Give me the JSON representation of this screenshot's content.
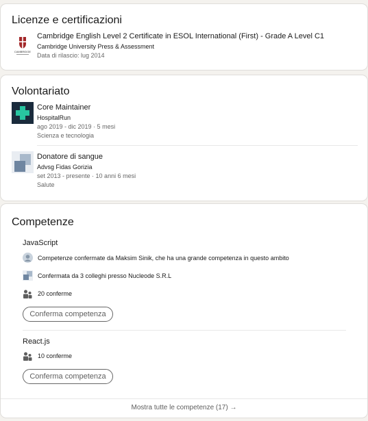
{
  "licenses": {
    "title": "Licenze e certificazioni",
    "items": [
      {
        "name": "Cambridge English Level 2 Certificate in ESOL International (First) - Grade A Level C1",
        "issuer": "Cambridge University Press & Assessment",
        "date": "Data di rilascio: lug 2014",
        "logo_text": "CAMBRIDGE"
      }
    ]
  },
  "volunteering": {
    "title": "Volontariato",
    "items": [
      {
        "role": "Core Maintainer",
        "org": "HospitalRun",
        "dates": "ago 2019 - dic 2019 · 5 mesi",
        "cause": "Scienza e tecnologia",
        "logo_bg": "#1a2b3c",
        "logo_accent": "#28c5a0"
      },
      {
        "role": "Donatore di sangue",
        "org": "Advsg Fidas Gorizia",
        "dates": "set 2013 - presente · 10 anni 6 mesi",
        "cause": "Salute"
      }
    ]
  },
  "skills": {
    "title": "Competenze",
    "items": [
      {
        "name": "JavaScript",
        "endorse_person": "Competenze confermate da Maksim Sinik, che ha una grande competenza in questo ambito",
        "endorse_colleagues": "Confermata da 3 colleghi presso Nucleode S.R.L",
        "count": "20 conferme",
        "button": "Conferma competenza"
      },
      {
        "name": "React.js",
        "count": "10 conferme",
        "button": "Conferma competenza"
      }
    ],
    "show_all": "Mostra tutte le competenze (17) →"
  }
}
